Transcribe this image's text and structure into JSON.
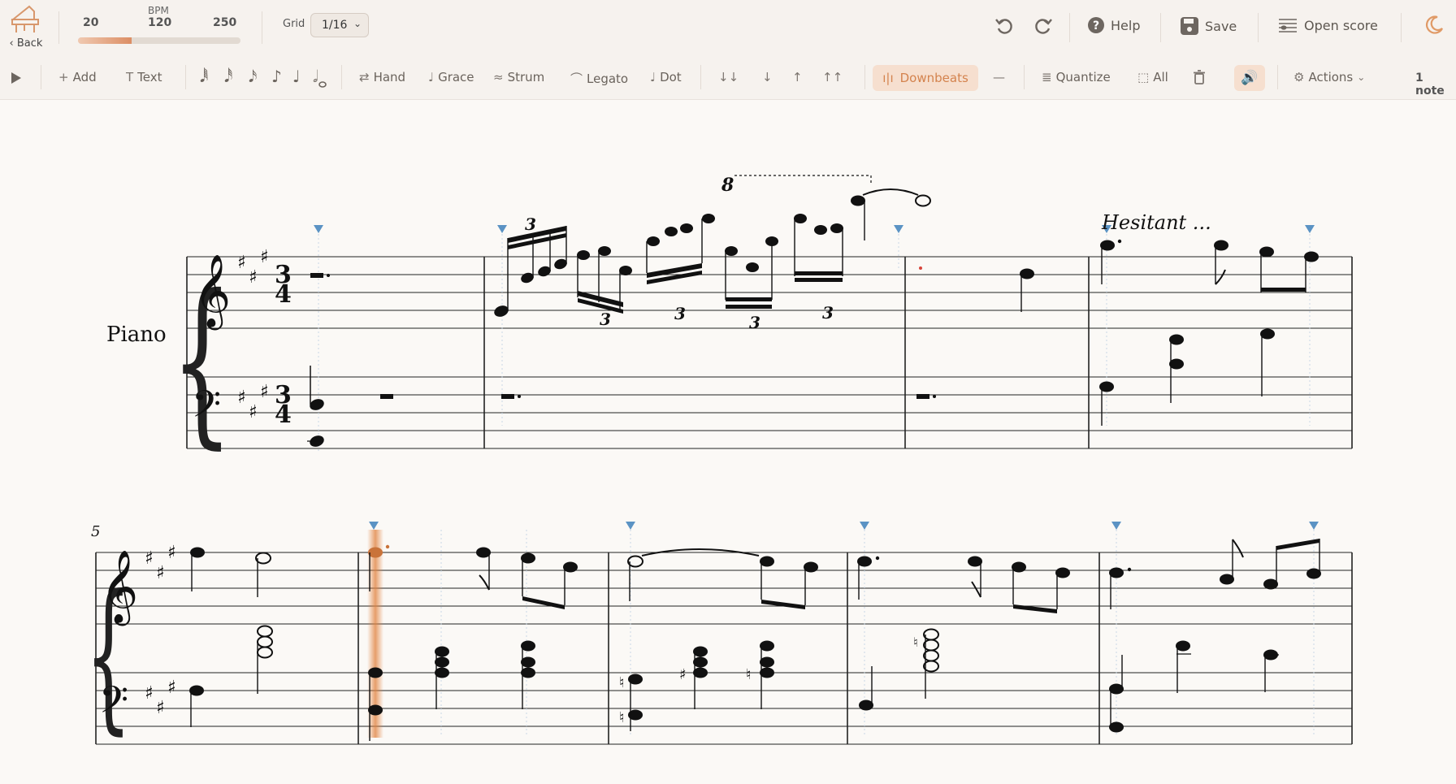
{
  "header": {
    "back_label": "Back",
    "bpm": {
      "caption": "BPM",
      "min": "20",
      "current": "120",
      "max": "250",
      "fraction": 0.33
    },
    "grid": {
      "label": "Grid",
      "value": "1/16"
    },
    "help_label": "Help",
    "save_label": "Save",
    "open_score_label": "Open score"
  },
  "toolbar": {
    "add": "Add",
    "text": "Text",
    "note_values": [
      "64th",
      "32nd",
      "16th",
      "8th",
      "quarter",
      "half",
      "whole"
    ],
    "hand": "Hand",
    "grace": "Grace",
    "strum": "Strum",
    "legato": "Legato",
    "dot": "Dot",
    "downbeats": "Downbeats",
    "quantize": "Quantize",
    "all": "All",
    "actions": "Actions",
    "selection_count": "1 note"
  },
  "score": {
    "instrument": "Piano",
    "time_signature": "3/4",
    "key_signature": "A major (3 sharps)",
    "expression": "Hesitant ...",
    "octave_mark": "8",
    "tuplet": "3",
    "second_system_measure_number": "5"
  },
  "colors": {
    "accent": "#dc8e64",
    "accent_bg": "#f6dfcf",
    "marker": "#5b93c4",
    "playhead": "#e0823f"
  }
}
